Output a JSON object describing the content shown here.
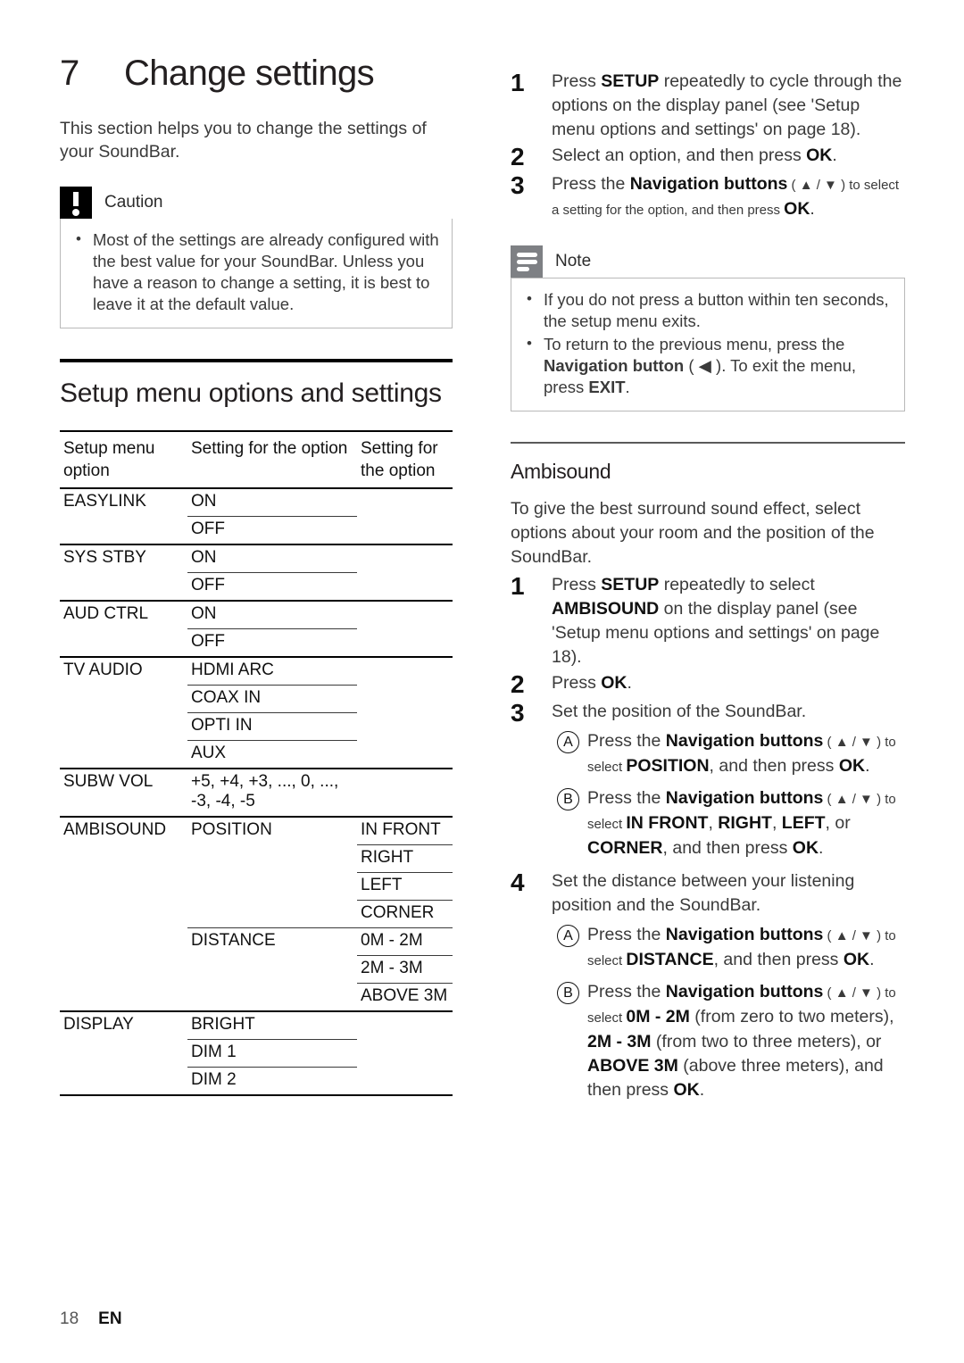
{
  "chapter": {
    "number": "7",
    "title": "Change settings",
    "intro": "This section helps you to change the settings of your SoundBar."
  },
  "caution": {
    "icon": "exclamation-icon",
    "label": "Caution",
    "items": [
      "Most of the settings are already configured with the best value for your SoundBar. Unless you have a reason to change a setting, it is best to leave it at the default value."
    ]
  },
  "setup_section": {
    "title": "Setup menu options and settings",
    "table": {
      "headers": [
        "Setup menu option",
        "Setting for the option",
        "Setting for the option"
      ],
      "rows": [
        {
          "c1": "EASYLINK",
          "c2": "ON",
          "c3": "",
          "group_start": true
        },
        {
          "c1": "",
          "c2": "OFF",
          "c3": "",
          "group_start": false
        },
        {
          "c1": "SYS STBY",
          "c2": "ON",
          "c3": "",
          "group_start": true
        },
        {
          "c1": "",
          "c2": "OFF",
          "c3": "",
          "group_start": false
        },
        {
          "c1": "AUD CTRL",
          "c2": "ON",
          "c3": "",
          "group_start": true
        },
        {
          "c1": "",
          "c2": "OFF",
          "c3": "",
          "group_start": false
        },
        {
          "c1": "TV AUDIO",
          "c2": "HDMI ARC",
          "c3": "",
          "group_start": true
        },
        {
          "c1": "",
          "c2": "COAX IN",
          "c3": "",
          "group_start": false
        },
        {
          "c1": "",
          "c2": "OPTI IN",
          "c3": "",
          "group_start": false
        },
        {
          "c1": "",
          "c2": "AUX",
          "c3": "",
          "group_start": false
        },
        {
          "c1": "SUBW VOL",
          "c2": "+5, +4, +3, ..., 0, ..., -3, -4, -5",
          "c3": "",
          "group_start": true
        },
        {
          "c1": "AMBISOUND",
          "c2": "POSITION",
          "c3": "IN FRONT",
          "group_start": true
        },
        {
          "c1": "",
          "c2": "",
          "c3": "RIGHT",
          "group_start": false
        },
        {
          "c1": "",
          "c2": "",
          "c3": "LEFT",
          "group_start": false
        },
        {
          "c1": "",
          "c2": "",
          "c3": "CORNER",
          "group_start": false
        },
        {
          "c1": "",
          "c2": "DISTANCE",
          "c3": "0M - 2M",
          "group_start": false
        },
        {
          "c1": "",
          "c2": "",
          "c3": "2M - 3M",
          "group_start": false
        },
        {
          "c1": "",
          "c2": "",
          "c3": "ABOVE 3M",
          "group_start": false
        },
        {
          "c1": "DISPLAY",
          "c2": "BRIGHT",
          "c3": "",
          "group_start": true
        },
        {
          "c1": "",
          "c2": "DIM 1",
          "c3": "",
          "group_start": false
        },
        {
          "c1": "",
          "c2": "DIM 2",
          "c3": "",
          "group_start": false
        }
      ]
    }
  },
  "right_steps": {
    "step1": {
      "num": "1",
      "text_a": "Press ",
      "bold_a": "SETUP",
      "text_b": " repeatedly to cycle through the options on the display panel (see 'Setup menu options and settings' on page 18)."
    },
    "step2": {
      "num": "2",
      "text_a": "Select an option, and then press ",
      "bold_a": "OK",
      "text_b": "."
    },
    "step3": {
      "num": "3",
      "text_a": "Press the ",
      "bold_a": "Navigation buttons",
      "text_b": " ( ▲ / ▼ ) to select a setting for the option, and then press ",
      "bold_b": "OK",
      "text_c": "."
    }
  },
  "note": {
    "icon": "lines-icon",
    "label": "Note",
    "items": [
      {
        "text_a": "If you do not press a button within ten seconds, the setup menu exits."
      },
      {
        "text_a": "To return to the previous menu, press the ",
        "bold_a": "Navigation button",
        "text_b": " ( ◀ ). To exit the menu, press ",
        "bold_b": "EXIT",
        "text_c": "."
      }
    ]
  },
  "ambisound": {
    "title": "Ambisound",
    "intro": "To give the best surround sound effect, select options about your room and the position of the SoundBar.",
    "step1": {
      "num": "1",
      "text_a": "Press ",
      "bold_a": "SETUP",
      "text_b": " repeatedly to select ",
      "bold_b": "AMBISOUND",
      "text_c": " on the display panel (see 'Setup menu options and settings' on page 18)."
    },
    "step2": {
      "num": "2",
      "text_a": "Press ",
      "bold_a": "OK",
      "text_b": "."
    },
    "step3": {
      "num": "3",
      "text_a": "Set the position of the SoundBar.",
      "sub_a": {
        "mark": "A",
        "text_a": "Press the ",
        "bold_a": "Navigation buttons",
        "text_b": " ( ▲ / ▼ ) to select ",
        "bold_b": "POSITION",
        "text_c": ", and then press ",
        "bold_c": "OK",
        "text_d": "."
      },
      "sub_b": {
        "mark": "B",
        "text_a": "Press the ",
        "bold_a": "Navigation buttons",
        "text_b": " ( ▲ / ▼ ) to select ",
        "bold_b": "IN FRONT",
        "text_c": ", ",
        "bold_c": "RIGHT",
        "text_d": ", ",
        "bold_d": "LEFT",
        "text_e": ", or ",
        "bold_e": "CORNER",
        "text_f": ", and then press ",
        "bold_f": "OK",
        "text_g": "."
      }
    },
    "step4": {
      "num": "4",
      "text_a": "Set the distance between your listening position and the SoundBar.",
      "sub_a": {
        "mark": "A",
        "text_a": "Press the ",
        "bold_a": "Navigation buttons",
        "text_b": " ( ▲ / ▼ ) to select ",
        "bold_b": "DISTANCE",
        "text_c": ", and then press ",
        "bold_c": "OK",
        "text_d": "."
      },
      "sub_b": {
        "mark": "B",
        "text_a": "Press the ",
        "bold_a": "Navigation buttons",
        "text_b": " ( ▲ / ▼ ) to select ",
        "bold_b": "0M - 2M",
        "text_c": " (from zero to two meters), ",
        "bold_c": "2M - 3M",
        "text_d": " (from two to three meters), or ",
        "bold_d": "ABOVE 3M",
        "text_e": " (above three meters), and then press ",
        "bold_e": "OK",
        "text_f": "."
      }
    }
  },
  "footer": {
    "page_number": "18",
    "language": "EN"
  }
}
